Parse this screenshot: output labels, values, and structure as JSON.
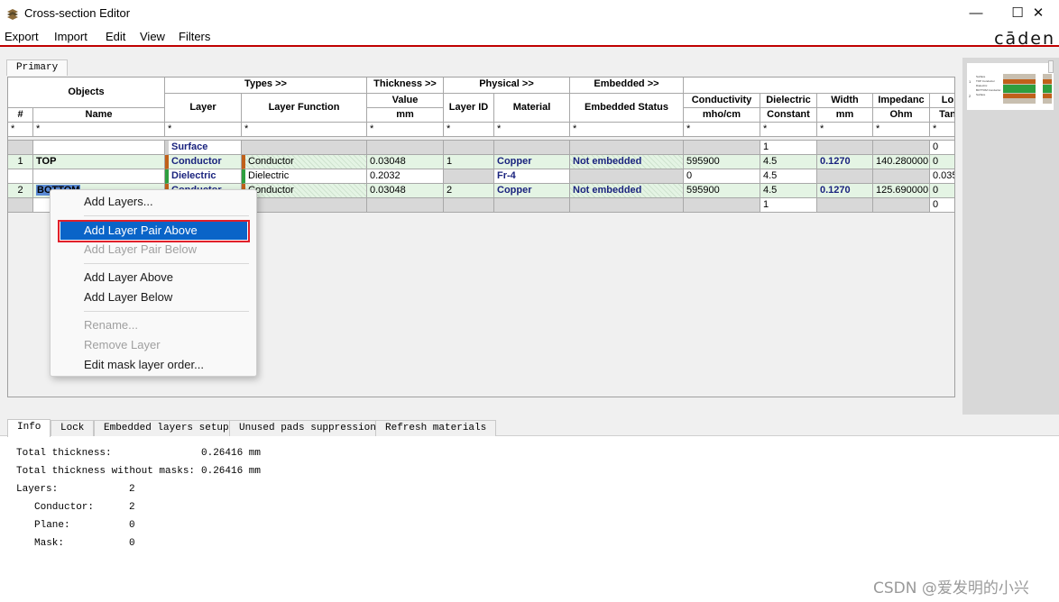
{
  "window": {
    "title": "Cross-section Editor",
    "brand": "cāden"
  },
  "menu": [
    "Export",
    "Import",
    "Edit",
    "View",
    "Filters"
  ],
  "top_tab": "Primary",
  "grid": {
    "group_headers": {
      "objects": "Objects",
      "types": "Types >>",
      "thickness": "Thickness >>",
      "physical": "Physical >>",
      "embedded": "Embedded >>"
    },
    "col_headers": {
      "num": "#",
      "name": "Name",
      "layer": "Layer",
      "layer_function": "Layer Function",
      "value": "Value",
      "value_unit": "mm",
      "layer_id": "Layer ID",
      "material": "Material",
      "embedded_status": "Embedded Status",
      "conductivity": "Conductivity",
      "conductivity_unit": "mho/cm",
      "dielectric": "Dielectric",
      "dielectric2": "Constant",
      "width": "Width",
      "width_unit": "mm",
      "impedance": "Impedanc",
      "impedance_unit": "Ohm",
      "loss": "Lo",
      "loss2": "Tan"
    },
    "filter": "*",
    "rows": [
      {
        "num": "",
        "name": "",
        "layer": "Surface",
        "function": "",
        "value": "",
        "layer_id": "",
        "material": "",
        "embedded": "",
        "conductivity": "",
        "dielectric": "1",
        "width": "",
        "impedance": "",
        "loss": "0"
      },
      {
        "num": "1",
        "name": "TOP",
        "layer": "Conductor",
        "function": "Conductor",
        "value": "0.03048",
        "layer_id": "1",
        "material": "Copper",
        "embedded": "Not embedded",
        "conductivity": "595900",
        "dielectric": "4.5",
        "width": "0.1270",
        "impedance": "140.280000",
        "loss": "0"
      },
      {
        "num": "",
        "name": "",
        "layer": "Dielectric",
        "function": "Dielectric",
        "value": "0.2032",
        "layer_id": "",
        "material": "Fr-4",
        "embedded": "",
        "conductivity": "0",
        "dielectric": "4.5",
        "width": "",
        "impedance": "",
        "loss": "0.035"
      },
      {
        "num": "2",
        "name": "BOTTOM",
        "layer": "Conductor",
        "function": "Conductor",
        "value": "0.03048",
        "layer_id": "2",
        "material": "Copper",
        "embedded": "Not embedded",
        "conductivity": "595900",
        "dielectric": "4.5",
        "width": "0.1270",
        "impedance": "125.690000",
        "loss": "0"
      },
      {
        "num": "",
        "name": "",
        "layer": "",
        "function": "",
        "value": "",
        "layer_id": "",
        "material": "",
        "embedded": "",
        "conductivity": "",
        "dielectric": "1",
        "width": "",
        "impedance": "",
        "loss": "0"
      }
    ]
  },
  "context_menu": {
    "add_layers": "Add Layers...",
    "add_pair_above": "Add Layer Pair Above",
    "add_pair_below": "Add Layer Pair Below",
    "add_above": "Add Layer Above",
    "add_below": "Add Layer Below",
    "rename": "Rename...",
    "remove": "Remove Layer",
    "edit_mask": "Edit mask layer order..."
  },
  "bottom_tabs": [
    "Info",
    "Lock",
    "Embedded layers setup",
    "Unused pads suppression",
    "Refresh materials"
  ],
  "info": {
    "total_thickness_label": "Total thickness:",
    "total_thickness_value": "0.26416 mm",
    "total_no_mask_label": "Total thickness without masks:",
    "total_no_mask_value": "0.26416 mm",
    "layers_label": "Layers:",
    "layers_value": "2",
    "conductor_label": "Conductor:",
    "conductor_value": "2",
    "plane_label": "Plane:",
    "plane_value": "0",
    "mask_label": "Mask:",
    "mask_value": "0"
  },
  "preview": {
    "labels": [
      "Surface",
      "TOP Conductor",
      "Dielectric",
      "BOTTOM Conductor",
      "Surface"
    ],
    "numbers": [
      "1",
      "2"
    ]
  },
  "watermark": "CSDN @爱发明的小兴",
  "colors": {
    "accent_red": "#c00000",
    "conductor": "#c0601a",
    "dielectric": "#2e9e3e",
    "highlight": "#0a64c8"
  }
}
